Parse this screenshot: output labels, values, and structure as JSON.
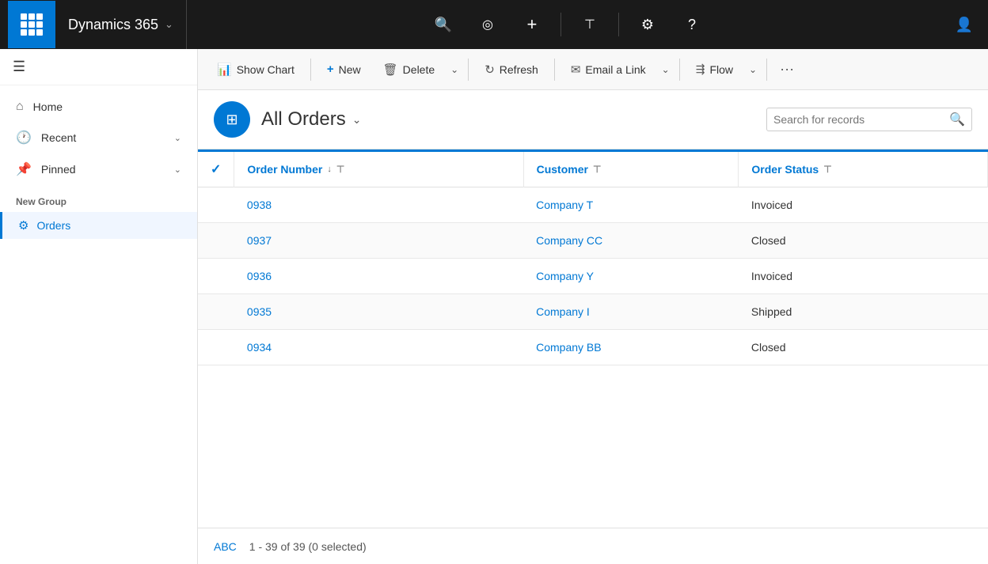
{
  "app": {
    "title": "Dynamics 365",
    "chevron": "⌄"
  },
  "topnav": {
    "search_icon": "🔍",
    "activity_icon": "◎",
    "add_icon": "+",
    "filter_icon": "⊤",
    "settings_icon": "⚙",
    "help_icon": "?",
    "user_icon": "👤"
  },
  "sidebar": {
    "hamburger": "☰",
    "nav_items": [
      {
        "label": "Home",
        "icon": "⌂"
      },
      {
        "label": "Recent",
        "icon": "🕐",
        "has_chevron": true
      },
      {
        "label": "Pinned",
        "icon": "📌",
        "has_chevron": true
      }
    ],
    "section_label": "New Group",
    "group_items": [
      {
        "label": "Orders",
        "icon": "⚙",
        "active": true
      }
    ]
  },
  "toolbar": {
    "show_chart": "Show Chart",
    "new": "New",
    "delete": "Delete",
    "refresh": "Refresh",
    "email_link": "Email a Link",
    "flow": "Flow",
    "more": "···"
  },
  "page_header": {
    "title": "All Orders",
    "search_placeholder": "Search for records"
  },
  "table": {
    "columns": [
      {
        "label": "Order Number",
        "has_sort": true,
        "has_filter": true
      },
      {
        "label": "Customer",
        "has_filter": true
      },
      {
        "label": "Order Status",
        "has_filter": true
      }
    ],
    "rows": [
      {
        "order_num": "0938",
        "customer": "Company T",
        "status": "Invoiced"
      },
      {
        "order_num": "0937",
        "customer": "Company CC",
        "status": "Closed"
      },
      {
        "order_num": "0936",
        "customer": "Company Y",
        "status": "Invoiced"
      },
      {
        "order_num": "0935",
        "customer": "Company I",
        "status": "Shipped"
      },
      {
        "order_num": "0934",
        "customer": "Company BB",
        "status": "Closed"
      }
    ]
  },
  "footer": {
    "abc": "ABC",
    "paging": "1 - 39 of 39 (0 selected)"
  }
}
